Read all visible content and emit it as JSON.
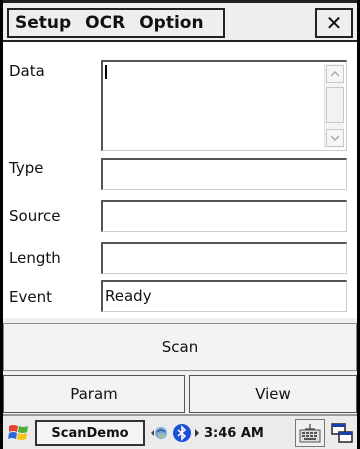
{
  "menu": {
    "items": [
      "Setup",
      "OCR",
      "Option"
    ],
    "close_symbol": "✕"
  },
  "form": {
    "data_label": "Data",
    "data_value": "",
    "type_label": "Type",
    "type_value": "",
    "source_label": "Source",
    "source_value": "",
    "length_label": "Length",
    "length_value": "",
    "event_label": "Event",
    "event_value": "Ready"
  },
  "buttons": {
    "scan": "Scan",
    "param": "Param",
    "view": "View"
  },
  "taskbar": {
    "start_icon": "windows-flag-icon",
    "app_name": "ScanDemo",
    "clock": "3:46 AM",
    "tray_icons": [
      "network-sync-icon",
      "bluetooth-icon",
      "keyboard-icon",
      "window-switch-icon"
    ]
  },
  "colors": {
    "background": "#f0f0f0",
    "bluetooth": "#1a4fd8"
  }
}
